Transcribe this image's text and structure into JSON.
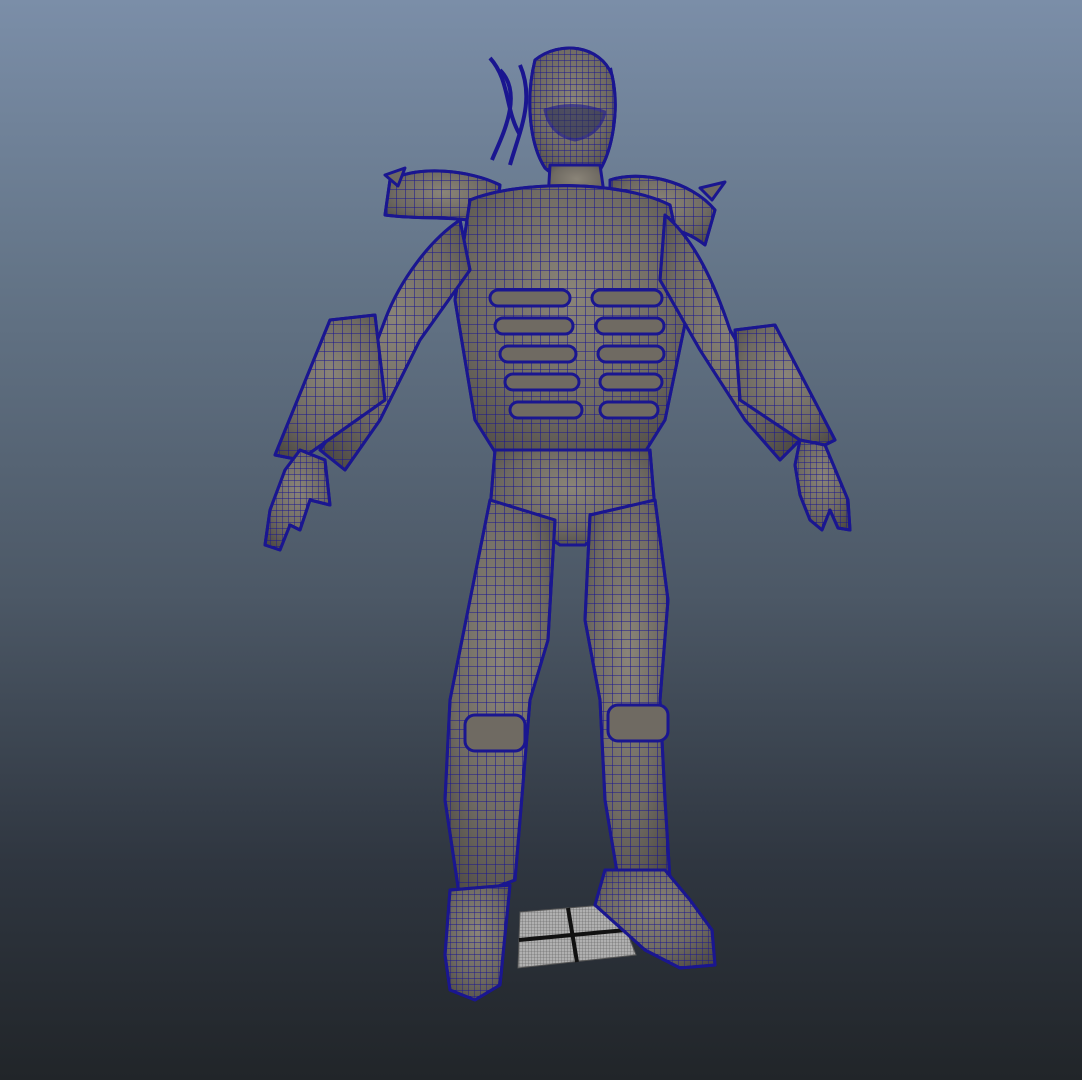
{
  "viewport": {
    "background_top": "#7b8ea8",
    "background_bottom": "#212529"
  },
  "model": {
    "shading": "wireframe-on-shaded",
    "wire_color": "#1a1690",
    "surface_color": "#6f6a62",
    "surface_highlight": "#8a8478",
    "surface_shadow": "#4e4a44"
  },
  "grid_plane": {
    "color": "#9a9a9a",
    "divider_color": "#111111"
  }
}
